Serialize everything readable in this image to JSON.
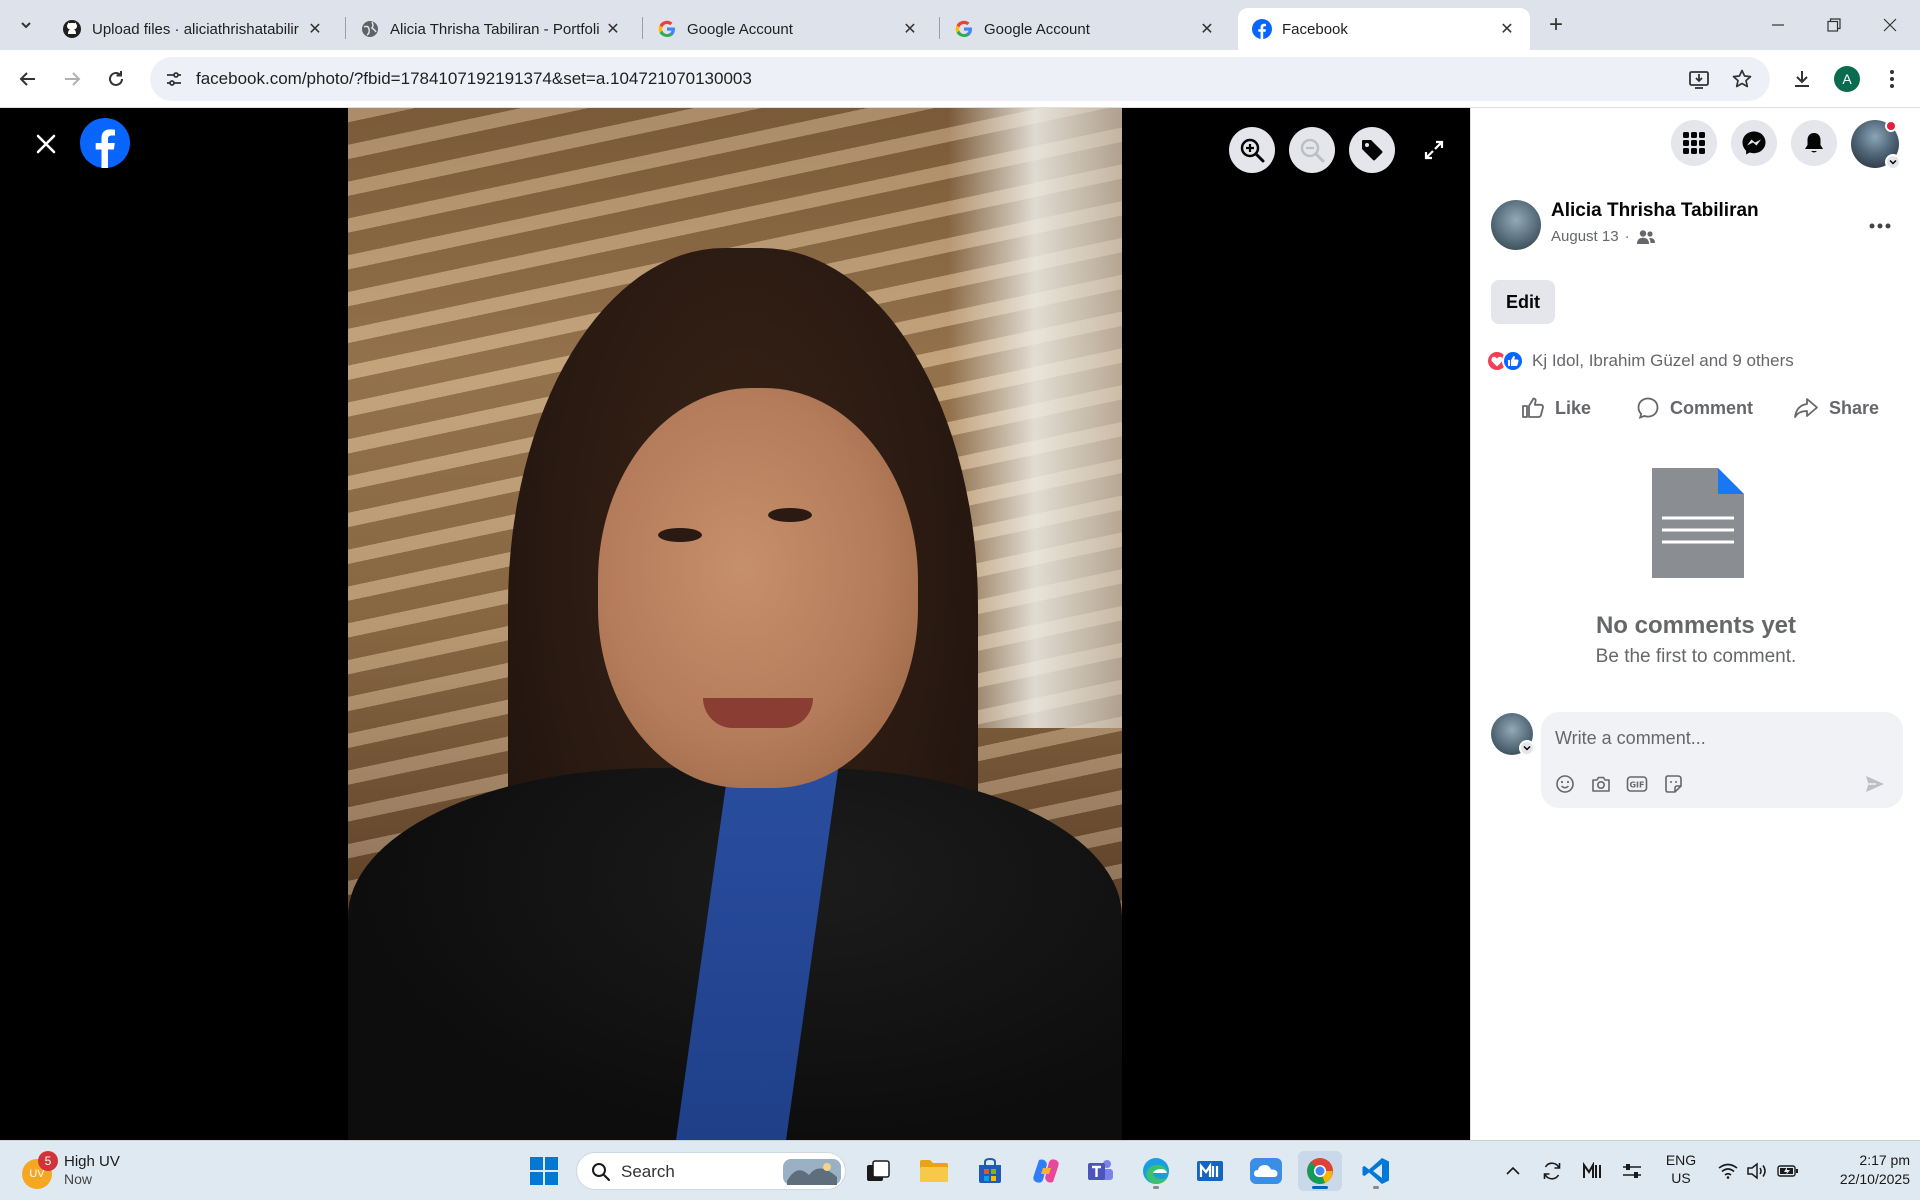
{
  "browser": {
    "tabs": [
      {
        "title": "Upload files · aliciathrishatabilir",
        "icon": "github-icon",
        "active": false
      },
      {
        "title": "Alicia Thrisha Tabiliran - Portfoli",
        "icon": "globe-icon",
        "active": false
      },
      {
        "title": "Google Account",
        "icon": "google-icon",
        "active": false
      },
      {
        "title": "Google Account",
        "icon": "google-icon",
        "active": false
      },
      {
        "title": "Facebook",
        "icon": "facebook-icon",
        "active": true
      }
    ],
    "url": "facebook.com/photo/?fbid=1784107192191374&set=a.104721070130003",
    "profile_initial": "A"
  },
  "viewer": {
    "photo_alt": "Selfie photo"
  },
  "post": {
    "author": "Alicia Thrisha Tabiliran",
    "date": "August 13",
    "separator": "·",
    "edit_label": "Edit",
    "reactions_text": "Kj Idol, Ibrahim Güzel and 9 others",
    "actions": {
      "like": "Like",
      "comment": "Comment",
      "share": "Share"
    },
    "empty_title": "No comments yet",
    "empty_sub": "Be the first to comment.",
    "comment_placeholder": "Write a comment..."
  },
  "taskbar": {
    "weather_title": "High UV",
    "weather_sub": "Now",
    "weather_badge": "5",
    "weather_icon_text": "UV",
    "search_label": "Search",
    "lang_line1": "ENG",
    "lang_line2": "US",
    "time": "2:17 pm",
    "date": "22/10/2025"
  },
  "colors": {
    "facebook_blue": "#0866ff",
    "tab_strip": "#dee3eb",
    "taskbar": "#dfe9f2"
  }
}
